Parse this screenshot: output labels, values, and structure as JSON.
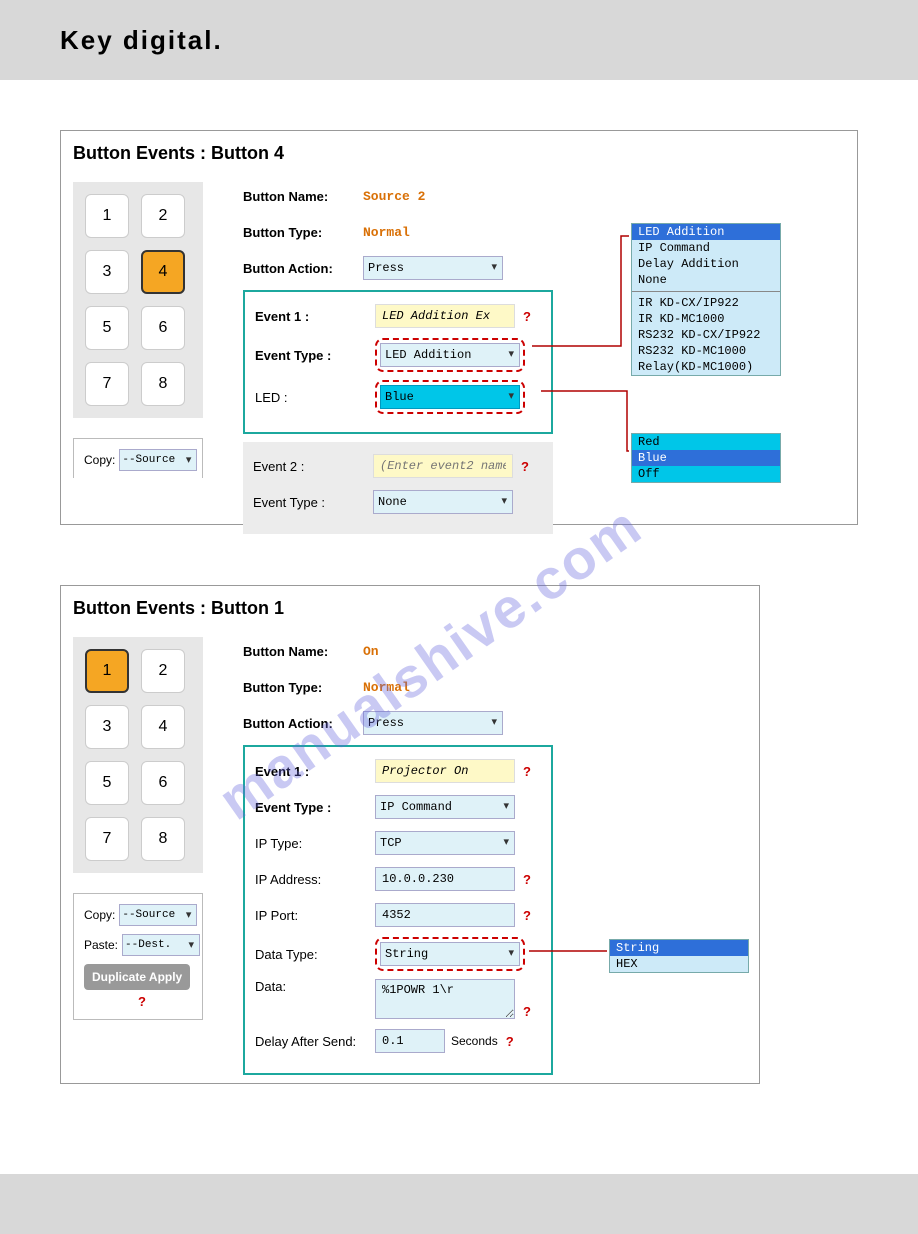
{
  "logo_text": "Key digital.",
  "panel1": {
    "title": "Button Events : Button 4",
    "buttons": [
      "1",
      "2",
      "3",
      "4",
      "5",
      "6",
      "7",
      "8"
    ],
    "selected": "4",
    "button_name_label": "Button Name:",
    "button_name_value": "Source 2",
    "button_type_label": "Button Type:",
    "button_type_value": "Normal",
    "button_action_label": "Button Action:",
    "button_action_value": "Press",
    "event1_label": "Event 1 :",
    "event1_name": "LED Addition Ex",
    "event1_type_label": "Event Type :",
    "event1_type_value": "LED Addition",
    "led_label": "LED :",
    "led_value": "Blue",
    "event2_label": "Event 2 :",
    "event2_placeholder": "(Enter event2 name)",
    "event2_type_label": "Event Type :",
    "event2_type_value": "None",
    "copy_label": "Copy:",
    "copy_value": "--Source",
    "dropdown1": {
      "items": [
        "LED Addition",
        "IP Command",
        "Delay Addition",
        "None"
      ],
      "items2": [
        "IR KD-CX/IP922",
        "IR KD-MC1000",
        "RS232 KD-CX/IP922",
        "RS232 KD-MC1000",
        "Relay(KD-MC1000)"
      ],
      "highlighted": "LED Addition"
    },
    "dropdown2": {
      "items": [
        "Red",
        "Blue",
        "Off"
      ],
      "highlighted": "Blue"
    }
  },
  "panel2": {
    "title": "Button Events : Button 1",
    "buttons": [
      "1",
      "2",
      "3",
      "4",
      "5",
      "6",
      "7",
      "8"
    ],
    "selected": "1",
    "button_name_label": "Button Name:",
    "button_name_value": "On",
    "button_type_label": "Button Type:",
    "button_type_value": "Normal",
    "button_action_label": "Button Action:",
    "button_action_value": "Press",
    "event1_label": "Event 1 :",
    "event1_name": "Projector On",
    "event1_type_label": "Event Type :",
    "event1_type_value": "IP Command",
    "ip_type_label": "IP Type:",
    "ip_type_value": "TCP",
    "ip_address_label": "IP Address:",
    "ip_address_value": "10.0.0.230",
    "ip_port_label": "IP Port:",
    "ip_port_value": "4352",
    "data_type_label": "Data Type:",
    "data_type_value": "String",
    "data_label": "Data:",
    "data_value": "%1POWR 1\\r",
    "delay_label": "Delay After Send:",
    "delay_value": "0.1",
    "delay_unit": "Seconds",
    "copy_label": "Copy:",
    "copy_value": "--Source",
    "paste_label": "Paste:",
    "paste_value": "--Dest.",
    "dup_btn": "Duplicate Apply",
    "dropdown": {
      "items": [
        "String",
        "HEX"
      ],
      "highlighted": "String"
    }
  },
  "watermark": "manualshive.com"
}
